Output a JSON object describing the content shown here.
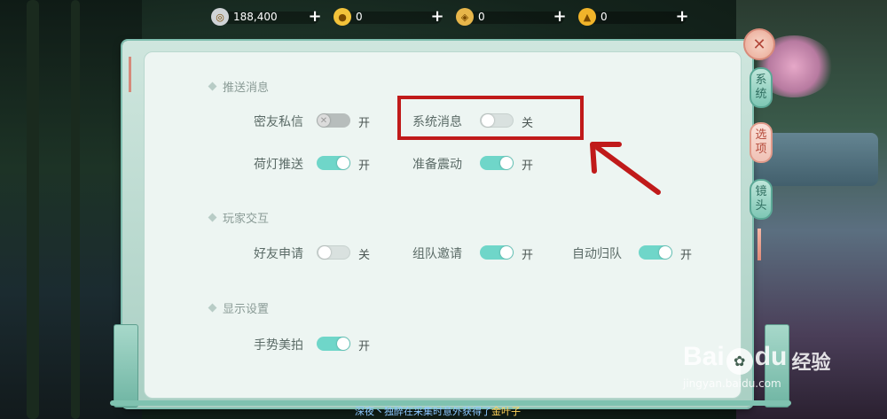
{
  "currencies": [
    {
      "icon": "silver-coin-icon",
      "amount": "188,400",
      "color": "#cfd3d6"
    },
    {
      "icon": "gold-coin-icon",
      "amount": "0",
      "color": "#f3c33a"
    },
    {
      "icon": "jade-token-icon",
      "amount": "0",
      "color": "#e7b64a"
    },
    {
      "icon": "gold-ingot-icon",
      "amount": "0",
      "color": "#f1b42a"
    }
  ],
  "plus_label": "+",
  "sections": {
    "push": "推送消息",
    "interaction": "玩家交互",
    "display": "显示设置"
  },
  "settings": {
    "friend_private": {
      "label": "密友私信",
      "state": "开",
      "toggle": "disabled"
    },
    "system_message": {
      "label": "系统消息",
      "state": "关",
      "toggle": "off"
    },
    "lotus_push": {
      "label": "荷灯推送",
      "state": "开",
      "toggle": "on"
    },
    "ready_vibrate": {
      "label": "准备震动",
      "state": "开",
      "toggle": "on"
    },
    "friend_request": {
      "label": "好友申请",
      "state": "关",
      "toggle": "off"
    },
    "team_invite": {
      "label": "组队邀请",
      "state": "开",
      "toggle": "on"
    },
    "auto_return": {
      "label": "自动归队",
      "state": "开",
      "toggle": "on"
    },
    "gesture_photo": {
      "label": "手势美拍",
      "state": "开",
      "toggle": "on"
    }
  },
  "tabs": [
    {
      "label_top": "系",
      "label_bottom": "统",
      "active": false
    },
    {
      "label_top": "选",
      "label_bottom": "项",
      "active": true
    },
    {
      "label_top": "镜",
      "label_bottom": "头",
      "active": false
    }
  ],
  "close_icon": "close-icon",
  "bottom_message": {
    "p1": "深夜丶",
    "p2": "独醉",
    "p3": "在采集时意外获得了",
    "p4": "金叶子"
  },
  "watermark": {
    "brand": "Bai",
    "brand2": "du",
    "cn": "经验",
    "url": "jingyan.baidu.com"
  },
  "accent_colors": {
    "toggle_on": "#6fd6c9",
    "highlight": "#c01a1a",
    "arrow": "#c01a1a"
  }
}
